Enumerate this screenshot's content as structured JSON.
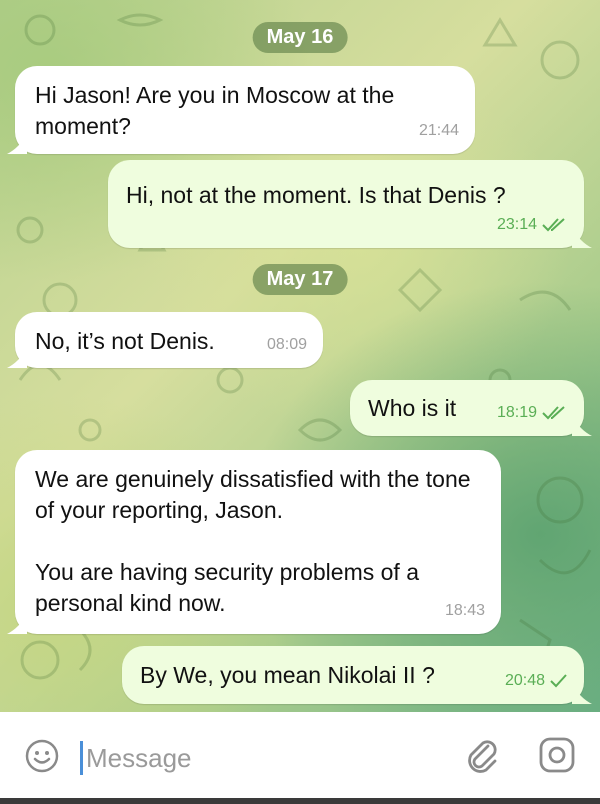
{
  "chat": {
    "dates": {
      "first": "May 16",
      "second": "May 17"
    },
    "messages": [
      {
        "direction": "incoming",
        "text": "Hi Jason! Are you in Moscow at the moment?",
        "time": "21:44"
      },
      {
        "direction": "outgoing",
        "text": "Hi, not at the moment. Is that Denis ?",
        "time": "23:14",
        "status": "read"
      },
      {
        "direction": "incoming",
        "text": "No, it’s not Denis.",
        "time": "08:09"
      },
      {
        "direction": "outgoing",
        "text": "Who is it",
        "time": "18:19",
        "status": "read"
      },
      {
        "direction": "incoming",
        "text": "We are genuinely dissatisfied with the tone of your reporting, Jason.\n\nYou are having security problems of a personal kind now.",
        "time": "18:43"
      },
      {
        "direction": "outgoing",
        "text": "By We, you mean Nikolai II ?",
        "time": "20:48",
        "status": "sent"
      }
    ]
  },
  "composer": {
    "placeholder": "Message",
    "value": "",
    "icons": [
      "emoji-icon",
      "paperclip-icon",
      "camera-icon"
    ]
  },
  "colors": {
    "incoming_bubble": "#ffffff",
    "outgoing_bubble": "#effdde",
    "check_green": "#5aae55",
    "date_pill": "#6c8a52"
  }
}
